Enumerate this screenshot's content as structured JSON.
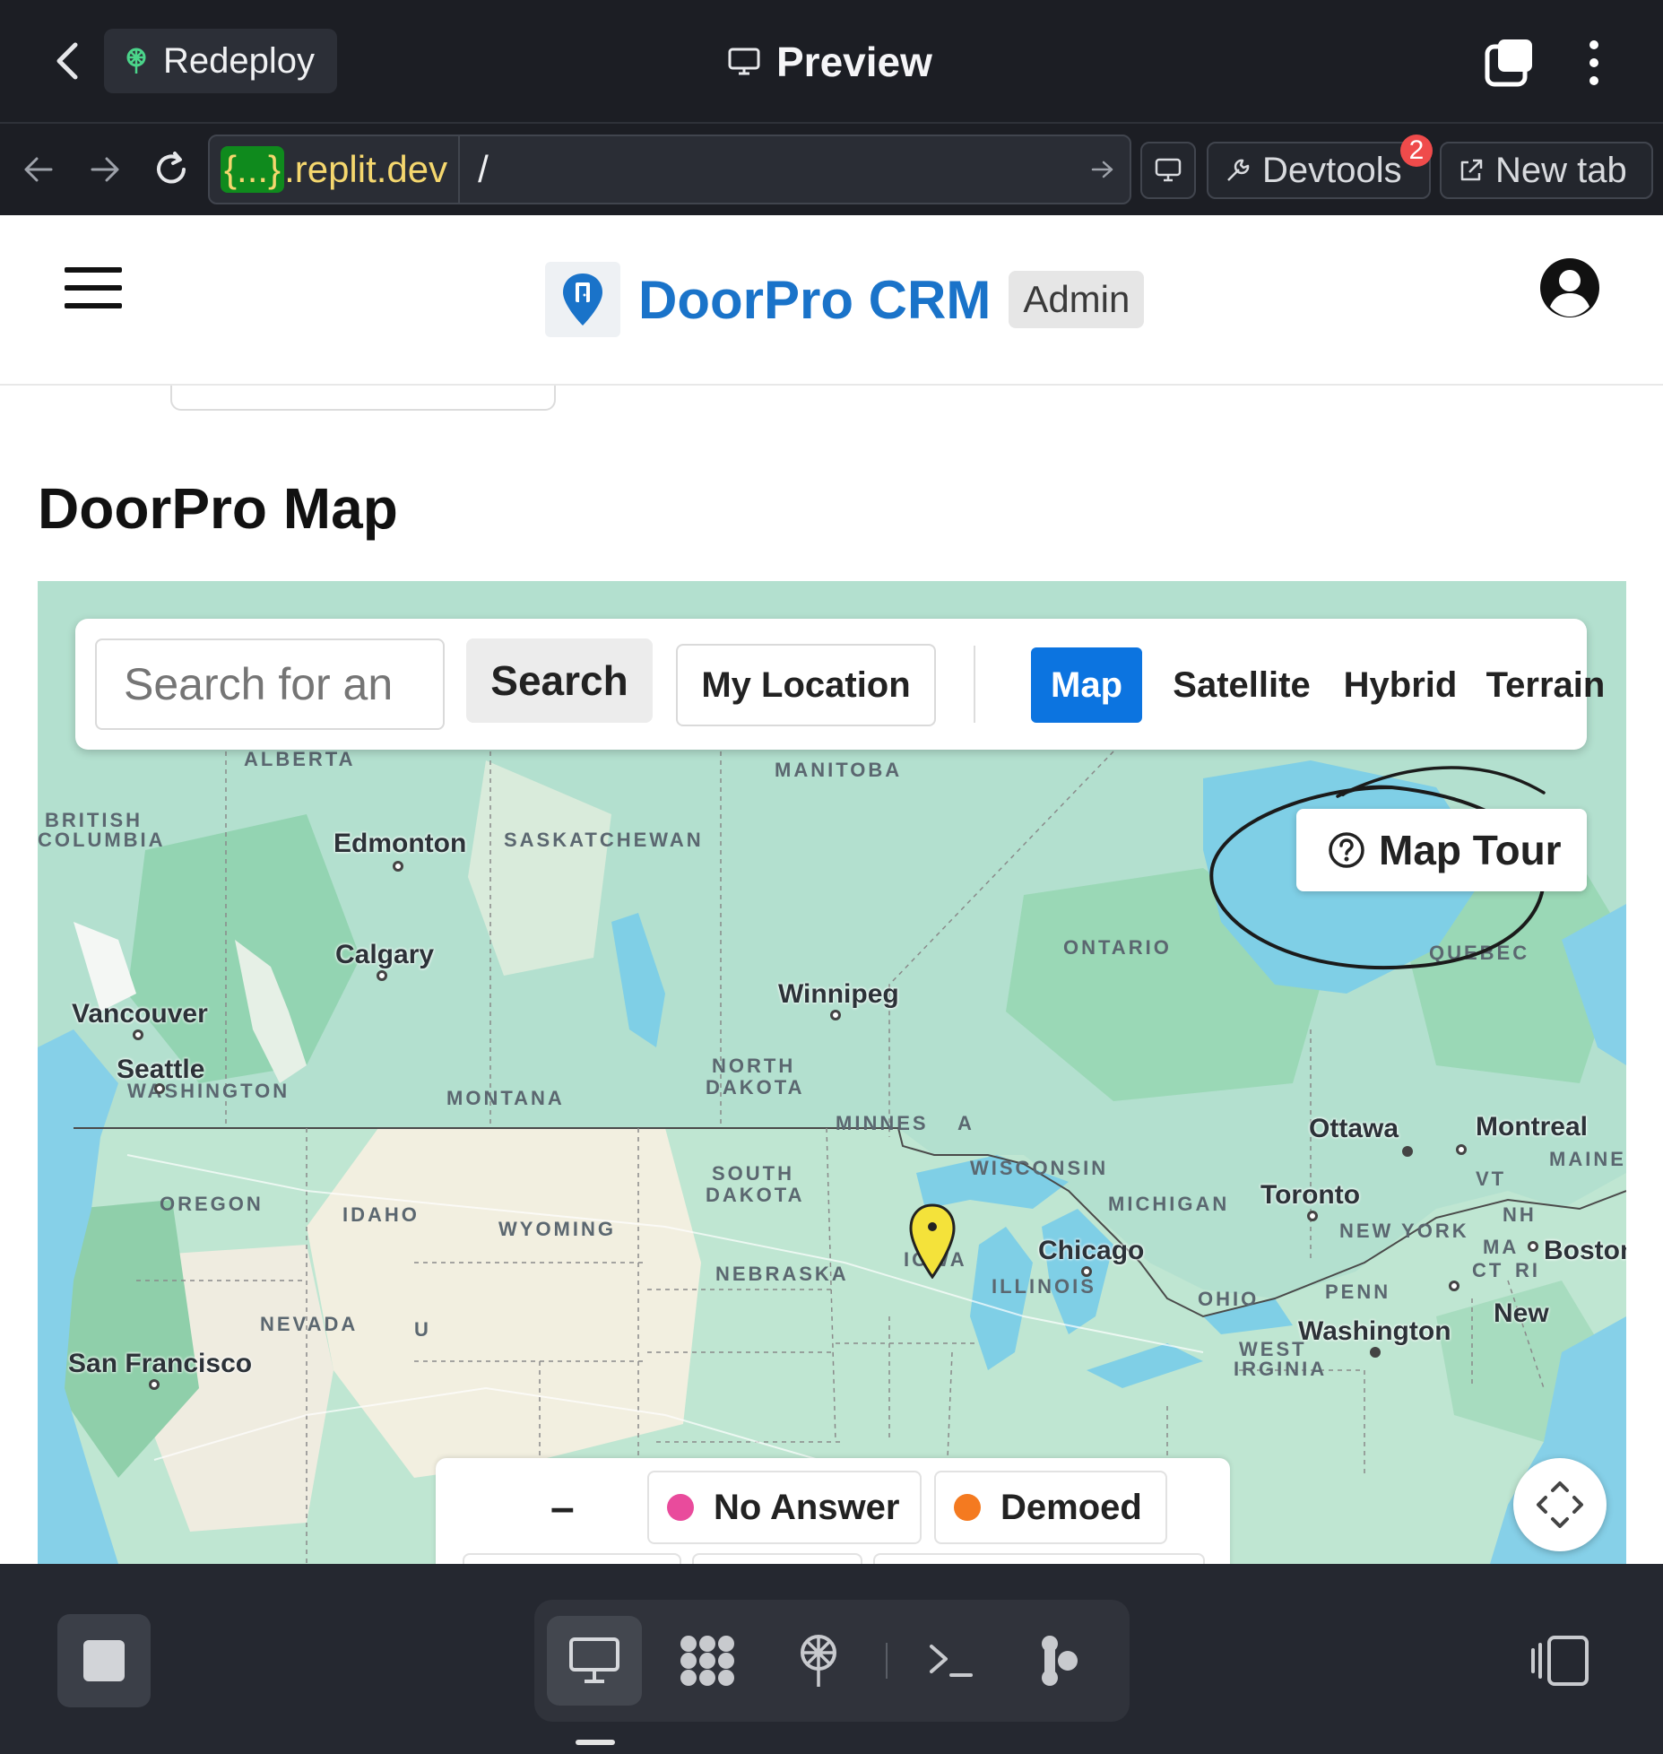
{
  "topbar": {
    "redeploy_label": "Redeploy",
    "title": "Preview"
  },
  "urlbar": {
    "domain_hash": "{...}",
    "domain_host": ".replit.dev",
    "path": "/",
    "devtools_label": "Devtools",
    "devtools_badge": "2",
    "new_tab_label": "New tab"
  },
  "header": {
    "brand_name": "DoorPro CRM",
    "role_badge": "Admin"
  },
  "page": {
    "title": "DoorPro Map"
  },
  "map_toolbar": {
    "search_placeholder": "Search for an",
    "search_label": "Search",
    "location_label": "My Location",
    "map_types": [
      "Map",
      "Satellite",
      "Hybrid",
      "Terrain"
    ],
    "active_map_type": "Map"
  },
  "map_tour": {
    "label": "Map Tour"
  },
  "map": {
    "regions": [
      "ALBERTA",
      "MANITOBA",
      "BRITISH",
      "COLUMBIA",
      "SASKATCHEWAN",
      "ONTARIO",
      "QUEBEC",
      "NORTH",
      "DAKOTA",
      "MONTANA",
      "WASHINGTON",
      "MINNES",
      "A",
      "SOUTH",
      "DAKOTA",
      "WISCONSIN",
      "OREGON",
      "IDAHO",
      "WYOMING",
      "MICHIGAN",
      "IOWA",
      "NEBRASKA",
      "ILLINOIS",
      "NEVADA",
      "OHIO",
      "PENN",
      "NEW YORK",
      "VT",
      "NH",
      "MA",
      "CT",
      "RI",
      "MAINE",
      "WEST",
      "IRGINIA",
      "U"
    ],
    "cities": [
      "Edmonton",
      "Calgary",
      "Vancouver",
      "Seattle",
      "Winnipeg",
      "Ottawa",
      "Montreal",
      "Toronto",
      "Chicago",
      "Boston",
      "Washington",
      "San Francisco",
      "New"
    ]
  },
  "legend": {
    "dash": "–",
    "items": [
      {
        "label": "No Answer",
        "color": "#e94b9c"
      },
      {
        "label": "Demoed",
        "color": "#f47a20"
      }
    ]
  },
  "colors": {
    "accent": "#0c74e0",
    "brand": "#1a73c9",
    "marker": "#f4e23a"
  }
}
